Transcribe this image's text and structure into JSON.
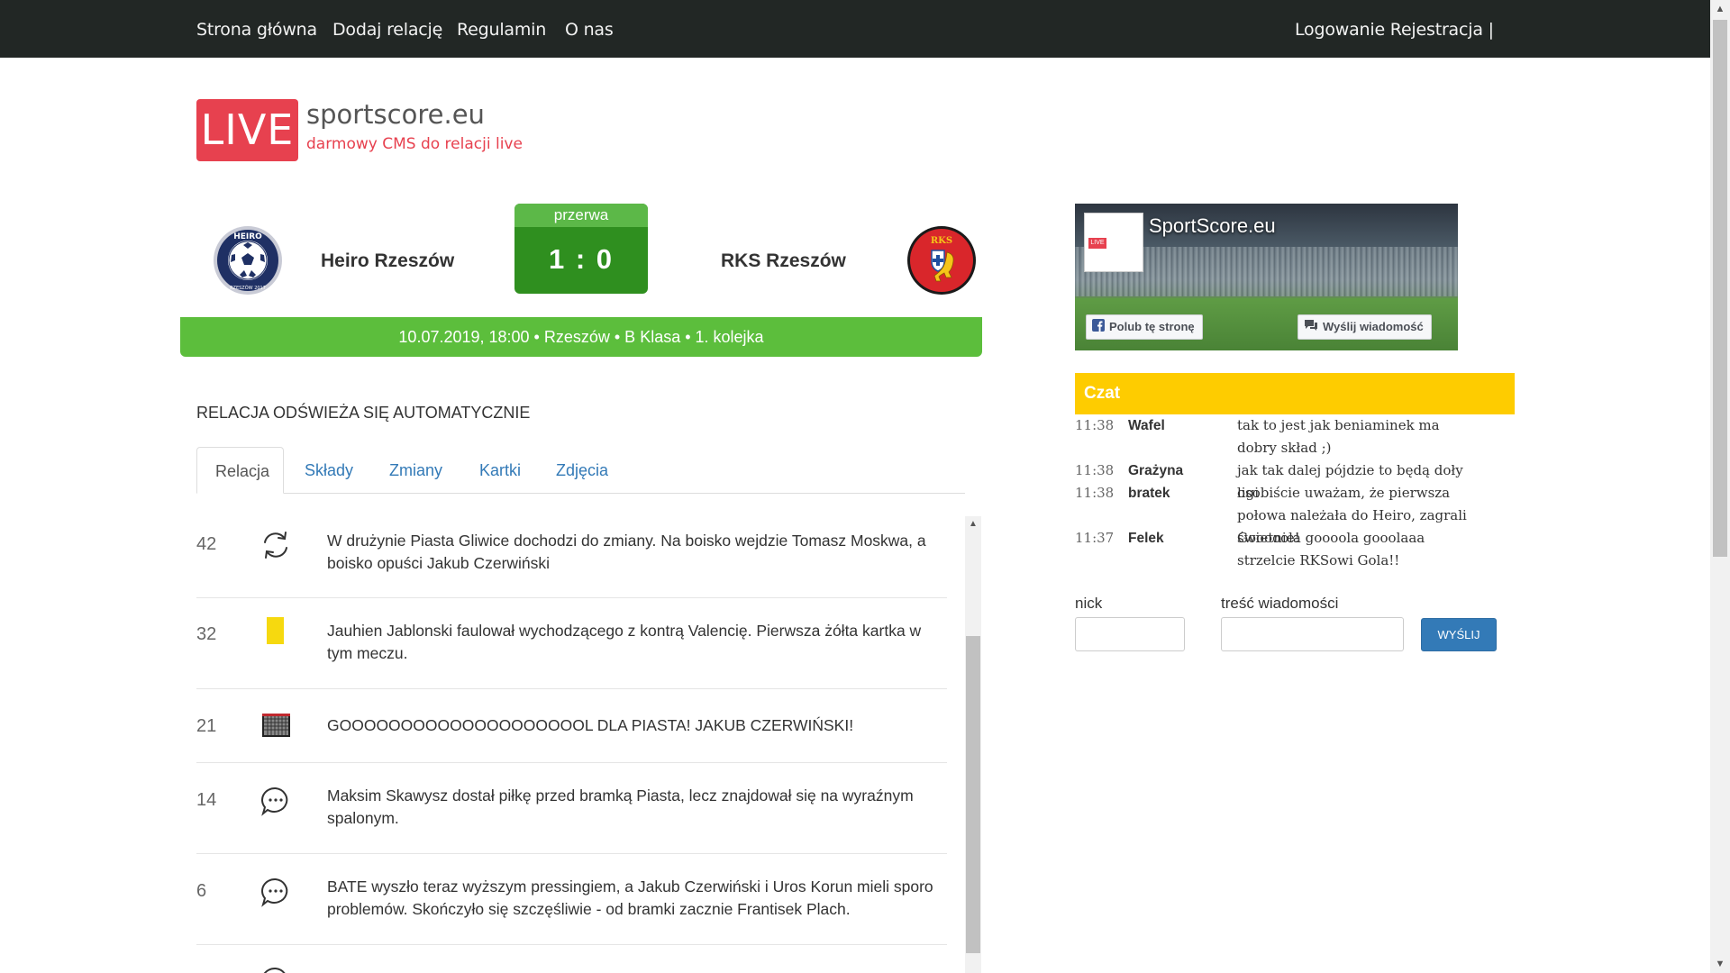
{
  "nav": {
    "home": "Strona główna",
    "add_report": "Dodaj relację",
    "rules": "Regulamin",
    "about": "O nas",
    "auth": "Logowanie Rejestracja |"
  },
  "logo": {
    "badge": "LIVE",
    "site": "sportscore.eu",
    "tagline": "darmowy CMS do relacji live"
  },
  "match": {
    "home_team": "Heiro Rzeszów",
    "away_team": "RKS Rzeszów",
    "status": "przerwa",
    "score": "1 : 0",
    "info": "10.07.2019, 18:00 • Rzeszów • B Klasa • 1. kolejka",
    "home_crest_text": "HEIRO",
    "home_crest_sub": "RZESZÓW 2017",
    "away_crest_text": "RKS"
  },
  "auto_refresh": "RELACJA ODŚWIEŻA SIĘ AUTOMATYCZNIE",
  "tabs": [
    "Relacja",
    "Składy",
    "Zmiany",
    "Kartki",
    "Zdjęcia"
  ],
  "events": [
    {
      "minute": "42",
      "icon": "substitution-icon",
      "text": "W drużynie Piasta Gliwice dochodzi do zmiany. Na boisko wejdzie Tomasz Moskwa, a boisko opuści Jakub Czerwiński"
    },
    {
      "minute": "32",
      "icon": "yellow-card-icon",
      "text": "Jauhien Jablonski faulował wychodzącego z kontrą Valencię. Pierwsza żółta kartka w tym meczu."
    },
    {
      "minute": "21",
      "icon": "goal-net-icon",
      "text": "GOOOOOOOOOOOOOOOOOOOOL DLA PIASTA! JAKUB CZERWIŃSKI!"
    },
    {
      "minute": "14",
      "icon": "comment-icon",
      "text": "Maksim Skawysz dostał piłkę przed bramką Piasta, lecz znajdował się na wyraźnym spalonym."
    },
    {
      "minute": "6",
      "icon": "comment-icon",
      "text": "BATE wyszło teraz wyższym pressingiem, a Jakub Czerwiński i Uros Korun mieli sporo problemów. Skończyło się szczęśliwie - od bramki zacznie Frantisek Plach."
    }
  ],
  "fb_widget": {
    "title": "SportScore.eu",
    "like": "Polub tę stronę",
    "message": "Wyślij wiadomość"
  },
  "chat": {
    "title": "Czat",
    "messages": [
      {
        "time": "11:38",
        "nick": "Wafel",
        "text": "tak to jest jak beniaminek ma dobry skład ;)"
      },
      {
        "time": "11:38",
        "nick": "Grażyna",
        "text": "jak tak dalej pójdzie to będą doły ligi"
      },
      {
        "time": "11:38",
        "nick": "bratek",
        "text": "osobiście uważam, że pierwsza połowa należała do Heiro, zagrali świetnie!"
      },
      {
        "time": "11:37",
        "nick": "Felek",
        "text": "Gooooola goooola gooolaaa strzelcie RKSowi Gola!!"
      }
    ],
    "nick_label": "nick",
    "message_label": "treść wiadomości",
    "nick_value": "",
    "message_value": "",
    "send": "WYŚLIJ"
  },
  "colors": {
    "nav_bg": "#222725",
    "brand_red": "#e7414f",
    "score_green": "#2f8f1f",
    "info_green": "#5cbe3c",
    "chat_yellow": "#fecc00",
    "link_blue": "#337ab7"
  }
}
